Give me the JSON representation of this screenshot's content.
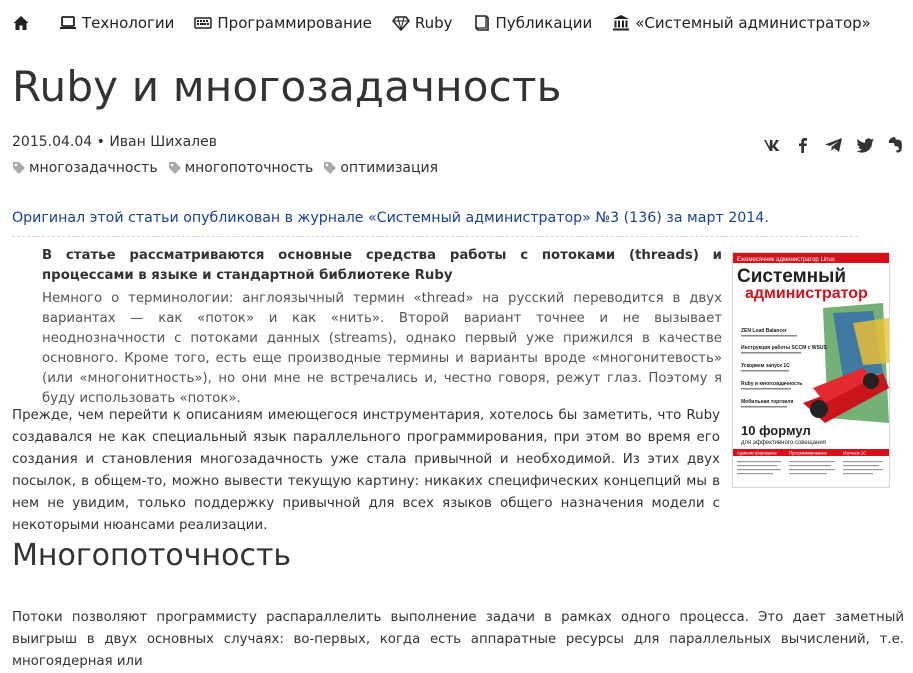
{
  "nav": {
    "items": [
      {
        "label": "Технологии"
      },
      {
        "label": "Программирование"
      },
      {
        "label": "Ruby"
      },
      {
        "label": "Публикации"
      },
      {
        "label": "«Системный администратор»"
      }
    ]
  },
  "article": {
    "title": "Ruby и многозадачность",
    "meta": "2015.04.04 • Иван Шихалев",
    "tags": [
      "многозадачность",
      "многопоточность",
      "оптимизация"
    ],
    "original_note": "Оригинал этой статьи опубликован в журнале «Системный администратор» №3 (136) за март 2014.",
    "lead": "В статье рассматриваются основные средства работы с потоками (threads) и процессами в языке и стандартной библиотеке Ruby",
    "terminology": "Немного о терминологии: англоязычный термин «thread» на русский переводится в двух вариантах — как «поток» и как «нить». Второй вариант точнее и не вызывает неоднозначности с потоками данных (streams), однако первый уже прижился в качестве основного. Кроме того, есть еще производные термины и варианты вроде «многонитевость» (или «многонитность»), но они мне не встречались и, честно говоря, режут глаз. Поэтому я буду использовать «поток».",
    "paragraph1": "Прежде, чем перейти к описаниям имеющегося инструментария, хотелось бы заметить, что Ruby создавался не как специальный язык параллельного программирования, при этом во время его создания и становления многозадачность уже стала привычной и необходимой. Из этих двух посылок, в общем-то, можно вывести текущую картину: никаких специфических концепций мы в нем не увидим, только поддержку привычной для всех языков общего назначения модели с некоторыми нюансами реализации.",
    "section_title": "Многопоточность",
    "paragraph2": "Потоки позволяют программисту распараллелить выполнение задачи в рамках одного процесса. Это дает заметный выигрыш в двух основных случаях: во-первых, когда есть аппаратные ресурсы для параллельных вычислений, т.е. многоядерная или"
  },
  "magazine": {
    "header": "Ежемесячник администратор Linux",
    "title_line1": "Системный",
    "title_line2": "администратор",
    "headlines": [
      "ZEN Load Balancer",
      "Инструкция работы SCCM с WSUS",
      "Ускоряем запуск 1С",
      "Ruby и многозадачность",
      "Мобильная торговля"
    ],
    "big_title": "10 формул",
    "big_sub": "для эффективного совещания",
    "bottom_tabs": [
      "Администрирование",
      "Программирование",
      "Изучаем 1С"
    ]
  },
  "colors": {
    "nav_text": "#222222",
    "link": "#1a3fa3",
    "magazine_red": "#d5121b",
    "magazine_dark": "#222222"
  }
}
